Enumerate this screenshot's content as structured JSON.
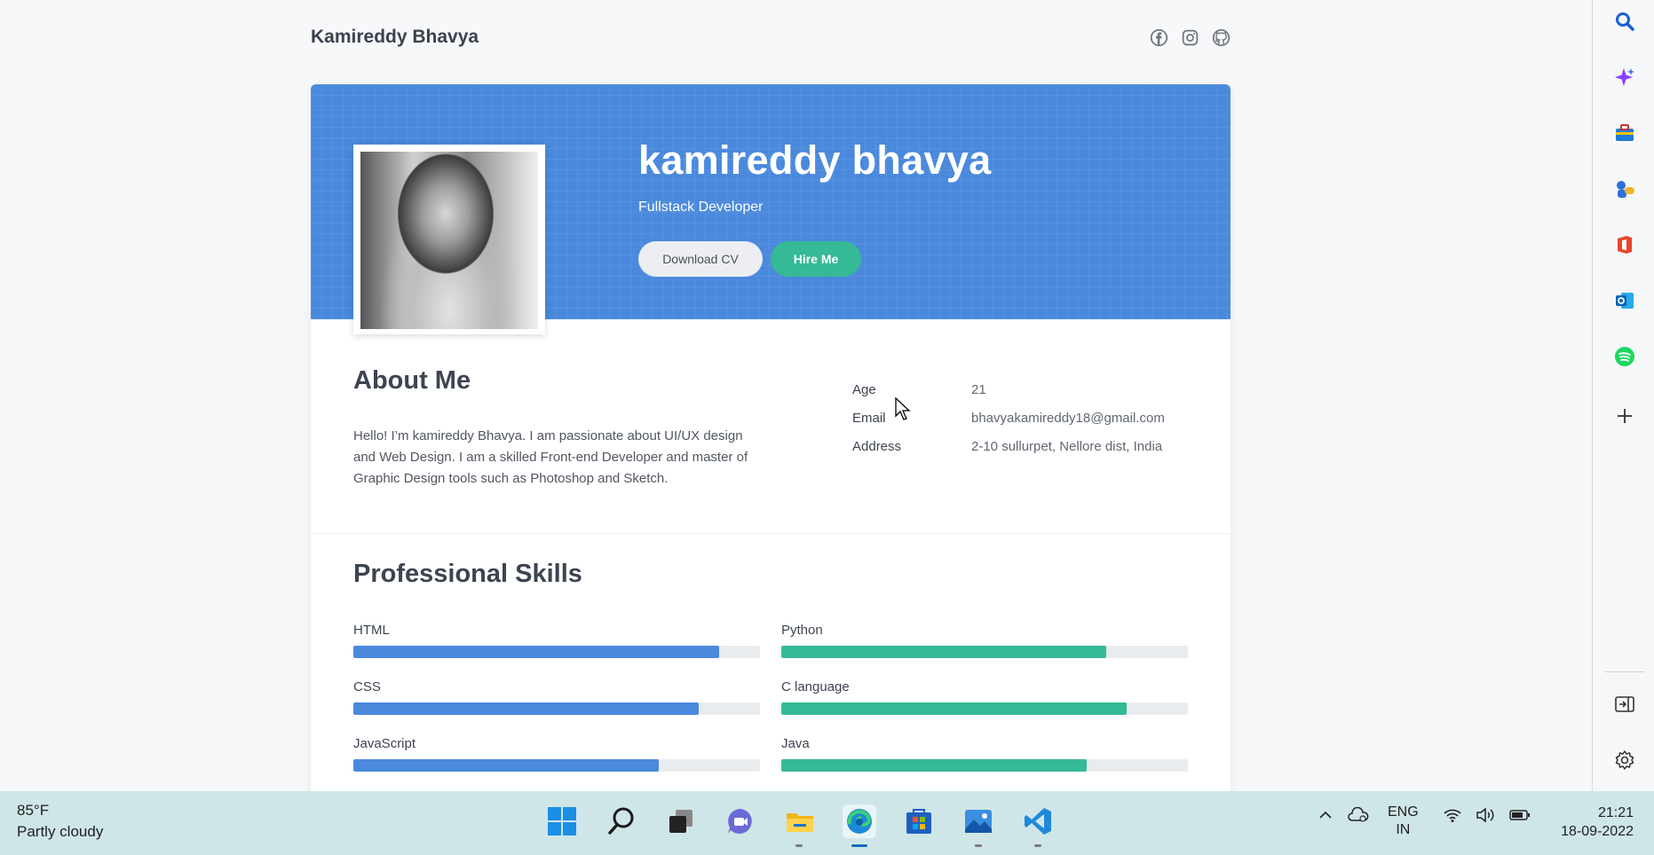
{
  "site": {
    "name": "Kamireddy Bhavya",
    "social_icons": [
      "facebook-icon",
      "instagram-icon",
      "github-icon"
    ]
  },
  "hero": {
    "name": "kamireddy bhavya",
    "title": "Fullstack Developer",
    "download_label": "Download CV",
    "hire_label": "Hire Me",
    "accent": "#4a89dc",
    "button_green": "#35b996"
  },
  "about": {
    "title": "About Me",
    "text": "Hello! I’m kamireddy Bhavya. I am passionate about UI/UX design and Web Design. I am a skilled Front-end Developer and master of Graphic Design tools such as Photoshop and Sketch.",
    "info": [
      {
        "label": "Age",
        "value": "21"
      },
      {
        "label": "Email",
        "value": "bhavyakamireddy18@gmail.com"
      },
      {
        "label": "Address",
        "value": "2-10 sullurpet, Nellore dist, India"
      }
    ]
  },
  "skills": {
    "title": "Professional Skills",
    "left": [
      {
        "label": "HTML",
        "percent": 90
      },
      {
        "label": "CSS",
        "percent": 85
      },
      {
        "label": "JavaScript",
        "percent": 75
      }
    ],
    "right": [
      {
        "label": "Python",
        "percent": 80
      },
      {
        "label": "C language",
        "percent": 85
      },
      {
        "label": "Java",
        "percent": 75
      }
    ]
  },
  "edge_panel": {
    "icons": [
      "search-icon",
      "copilot-icon",
      "tools-icon",
      "games-icon",
      "office-icon",
      "outlook-icon",
      "spotify-icon",
      "add-icon",
      "sidebar-toggle-icon",
      "settings-icon"
    ]
  },
  "taskbar": {
    "weather_temp": "85°F",
    "weather_desc": "Partly cloudy",
    "apps": [
      "start-icon",
      "search-icon",
      "task-view-icon",
      "teams-chat-icon",
      "file-explorer-icon",
      "edge-icon",
      "store-icon",
      "photos-icon",
      "vscode-icon"
    ],
    "lang_line1": "ENG",
    "lang_line2": "IN",
    "time": "21:21",
    "date": "18-09-2022"
  }
}
